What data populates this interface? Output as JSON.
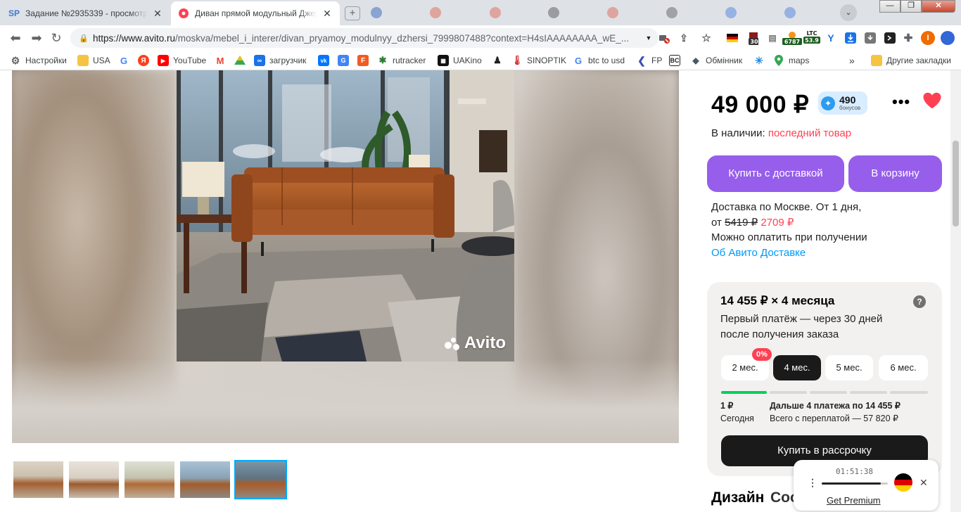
{
  "tabs": [
    {
      "title": "Задание №2935339 - просмотр з",
      "favicon": "SP"
    },
    {
      "title": "Диван прямой модульный Джерс",
      "favicon": "avito"
    }
  ],
  "address_bar": {
    "host_part": "https://www.avito.ru",
    "path_part": "/moskva/mebel_i_interer/divan_pryamoy_modulnyy_dzhersi_7999807488?context=H4sIAAAAAAAA_wE_..."
  },
  "extensions": {
    "badge_30": "30",
    "badge_6787": "6787",
    "ltc_label": "LTC",
    "ltc_value": "53.9",
    "profile_initial": "I"
  },
  "bookmarks": [
    {
      "label": "Настройки",
      "icon": "gear-icon"
    },
    {
      "label": "USA",
      "icon": "folder-icon"
    },
    {
      "label": "",
      "icon": "google-icon"
    },
    {
      "label": "",
      "icon": "yandex-icon"
    },
    {
      "label": "YouTube",
      "icon": "youtube-icon"
    },
    {
      "label": "",
      "icon": "gmail-icon"
    },
    {
      "label": "",
      "icon": "drive-icon"
    },
    {
      "label": "загрузчик",
      "icon": "loader-icon"
    },
    {
      "label": "",
      "icon": "vk-icon"
    },
    {
      "label": "",
      "icon": "translate-icon"
    },
    {
      "label": "",
      "icon": "f-icon"
    },
    {
      "label": "rutracker",
      "icon": "rutracker-icon"
    },
    {
      "label": "UAKino",
      "icon": "uakino-icon"
    },
    {
      "label": "",
      "icon": "person-icon"
    },
    {
      "label": "SINOPTIK",
      "icon": "thermometer-icon"
    },
    {
      "label": "btc to usd",
      "icon": "google-icon"
    },
    {
      "label": "FP",
      "icon": "fp-icon"
    },
    {
      "label": "",
      "icon": "bc-icon"
    },
    {
      "label": "Обмінник",
      "icon": "exchange-icon"
    },
    {
      "label": "",
      "icon": "snowflake-icon"
    },
    {
      "label": "maps",
      "icon": "map-pin-icon"
    }
  ],
  "bookmarks_more": "»",
  "other_bookmarks": "Другие закладки",
  "listing": {
    "price": "49 000 ₽",
    "bonus_value": "490",
    "bonus_label": "бонусов",
    "stock_label": "В наличии:",
    "stock_value": "последний товар",
    "buy_delivery_button": "Купить с доставкой",
    "cart_button": "В корзину",
    "delivery_line1": "Доставка по Москве. От 1 дня,",
    "delivery_from": "от",
    "delivery_old_price": "5419 ₽",
    "delivery_new_price": "2709 ₽",
    "pay_on_receipt": "Можно оплатить при получении",
    "about_delivery_link": "Об Авито Доставке",
    "watermark": "Avito"
  },
  "installment": {
    "title": "14 455 ₽ × 4 месяца",
    "description": "Первый платёж — через 30 дней после получения заказа",
    "terms": [
      "2 мес.",
      "4 мес.",
      "5 мес.",
      "6 мес."
    ],
    "selected_term_index": 1,
    "zero_badge": "0%",
    "today_amount": "1 ₽",
    "today_label": "Сегодня",
    "next_payments": "Дальше 4 платежа по 14 455 ₽",
    "total_overpay": "Всего с переплатой — 57 820 ₽",
    "buy_button": "Купить в рассрочку"
  },
  "section_heading_1": "Дизайн",
  "section_heading_2": "Соо",
  "player": {
    "time": "01:51:38",
    "premium_link": "Get Premium",
    "progress": 0.89
  },
  "colors": {
    "accent_purple": "#965eeb",
    "price_red": "#ff4053",
    "link_blue": "#0099f7",
    "progress_green": "#02d15c"
  }
}
